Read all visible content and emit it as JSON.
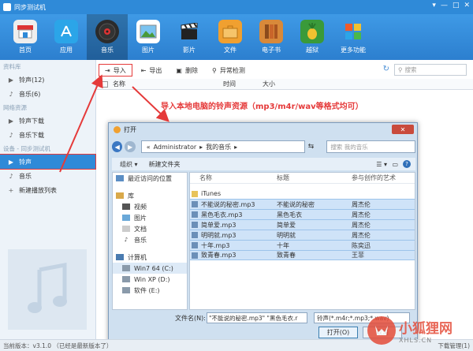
{
  "window": {
    "title": "同步测试机",
    "controls": [
      "▾",
      "—",
      "□",
      "✕"
    ]
  },
  "topbar": {
    "tools": [
      {
        "label": "首页",
        "icon": "store-icon",
        "color": "#e9e9e9"
      },
      {
        "label": "应用",
        "icon": "app-store-icon",
        "color": "#2ba5e8"
      },
      {
        "label": "音乐",
        "icon": "music-disc-icon",
        "color": "#2b2b2b",
        "active": true
      },
      {
        "label": "图片",
        "icon": "picture-icon",
        "color": "#e9e9e9"
      },
      {
        "label": "影片",
        "icon": "clapperboard-icon",
        "color": "#2b2b2b"
      },
      {
        "label": "文件",
        "icon": "briefcase-icon",
        "color": "#f0a030"
      },
      {
        "label": "电子书",
        "icon": "book-icon",
        "color": "#d8893a"
      },
      {
        "label": "越狱",
        "icon": "pineapple-icon",
        "color": "#f2c230"
      },
      {
        "label": "更多功能",
        "icon": "grid-icon",
        "color": "#f05a2a"
      }
    ]
  },
  "sidebar": {
    "groups": [
      {
        "title": "资料库",
        "items": [
          {
            "label": "铃声(12)",
            "icon": "bell-icon"
          },
          {
            "label": "音乐(6)",
            "icon": "note-icon"
          }
        ]
      },
      {
        "title": "网络资源",
        "items": [
          {
            "label": "铃声下载",
            "icon": "bell-icon"
          },
          {
            "label": "音乐下载",
            "icon": "note-icon"
          }
        ]
      },
      {
        "title": "设备 - 同步测试机",
        "items": [
          {
            "label": "铃声",
            "icon": "bell-icon",
            "selected": true
          },
          {
            "label": "音乐",
            "icon": "note-icon"
          },
          {
            "label": "新建播放列表",
            "icon": "plus-icon"
          }
        ]
      }
    ]
  },
  "toolbar": {
    "import": "导入",
    "export": "导出",
    "delete": "删除",
    "detect": "异常检测",
    "search_placeholder": "搜索"
  },
  "list_header": {
    "name": "名称",
    "time": "时间",
    "size": "大小"
  },
  "annotation": "导入本地电脑的铃声资源（mp3/m4r/wav等格式均可）",
  "status": {
    "version": "当前版本：v3.1.0 （已经是最新版本了）",
    "downloads": "下载管理(1)"
  },
  "dialog": {
    "title": "打开",
    "close": "✕",
    "path": [
      "Administrator",
      "我的音乐"
    ],
    "search_placeholder": "搜索 我的音乐",
    "organize": "组织 ▾",
    "new_folder": "新建文件夹",
    "nav": [
      {
        "label": "最近访问的位置",
        "icon": "recent-icon"
      },
      {
        "label": "库",
        "icon": "library-icon",
        "head": true
      },
      {
        "label": "视频",
        "icon": "video-icon"
      },
      {
        "label": "图片",
        "icon": "picture-icon"
      },
      {
        "label": "文档",
        "icon": "document-icon"
      },
      {
        "label": "音乐",
        "icon": "music-icon"
      },
      {
        "label": "计算机",
        "icon": "computer-icon",
        "head": true
      },
      {
        "label": "Win7 64 (C:)",
        "icon": "drive-icon",
        "sel": true
      },
      {
        "label": "Win XP (D:)",
        "icon": "drive-icon"
      },
      {
        "label": "软件 (E:)",
        "icon": "drive-icon"
      }
    ],
    "columns": {
      "name": "名称",
      "title": "标题",
      "artist": "参与创作的艺术"
    },
    "folder": "iTunes",
    "files": [
      {
        "name": "不能说的秘密.mp3",
        "title": "不能说的秘密",
        "artist": "周杰伦"
      },
      {
        "name": "黑色毛衣.mp3",
        "title": "黑色毛衣",
        "artist": "周杰伦"
      },
      {
        "name": "简单爱.mp3",
        "title": "简单爱",
        "artist": "周杰伦"
      },
      {
        "name": "明明就.mp3",
        "title": "明明就",
        "artist": "周杰伦"
      },
      {
        "name": "十年.mp3",
        "title": "十年",
        "artist": "陈奕迅"
      },
      {
        "name": "致青春.mp3",
        "title": "致青春",
        "artist": "王菲"
      }
    ],
    "filename_label": "文件名(N):",
    "filename_value": "\"不能说的秘密.mp3\" \"黑色毛衣.r",
    "filetype_value": "铃声(*.m4r;*.mp3;*.wav)",
    "open": "打开(O)",
    "cancel": "取消"
  },
  "watermark": {
    "main": "小狐狸网",
    "sub": "XHLS.CN"
  }
}
